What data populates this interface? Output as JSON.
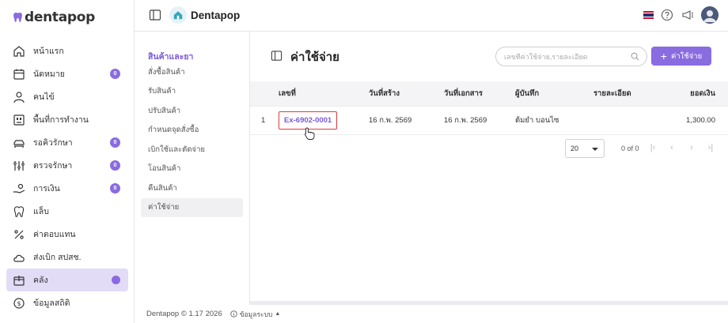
{
  "brand": {
    "name": "dentapop",
    "accent": "#8a6be0"
  },
  "sidebar": {
    "items": [
      {
        "label": "หน้าแรก",
        "icon": "home-icon",
        "badge": null
      },
      {
        "label": "นัดหมาย",
        "icon": "calendar-icon",
        "badge": "0"
      },
      {
        "label": "คนไข้",
        "icon": "user-icon",
        "badge": null
      },
      {
        "label": "พื้นที่การทำงาน",
        "icon": "workspace-icon",
        "badge": null
      },
      {
        "label": "รอคิวรักษา",
        "icon": "queue-icon",
        "badge": "0"
      },
      {
        "label": "ตรวจรักษา",
        "icon": "treatment-icon",
        "badge": "0"
      },
      {
        "label": "การเงิน",
        "icon": "finance-icon",
        "badge": "0"
      },
      {
        "label": "แล็บ",
        "icon": "tooth-icon",
        "badge": null
      },
      {
        "label": "ค่าตอบแทน",
        "icon": "percent-icon",
        "badge": null
      },
      {
        "label": "ส่งเบิก สปสช.",
        "icon": "cloud-icon",
        "badge": null
      },
      {
        "label": "คลัง",
        "icon": "inventory-icon",
        "badge": null,
        "active": true
      },
      {
        "label": "ข้อมูลสถิติ",
        "icon": "stats-icon",
        "badge": null
      }
    ]
  },
  "topbar": {
    "app_title": "Dentapop"
  },
  "subnav": {
    "title": "สินค้าและยา",
    "items": [
      "สั่งซื้อสินค้า",
      "รับสินค้า",
      "ปรับสินค้า",
      "กำหนดจุดสั่งซื้อ",
      "เบิกใช้และตัดจ่าย",
      "โอนสินค้า",
      "คืนสินค้า",
      "ค่าใช้จ่าย"
    ]
  },
  "page": {
    "title": "ค่าใช้จ่าย",
    "search_placeholder": "เลขที่ค่าใช้จ่าย,รายละเอียด",
    "add_label": "ค่าใช้จ่าย"
  },
  "table": {
    "headers": {
      "no": "เลขที่",
      "created": "วันที่สร้าง",
      "doc_date": "วันที่เอกสาร",
      "recorder": "ผู้บันทึก",
      "detail": "รายละเอียด",
      "amount": "ยอดเงิน"
    },
    "rows": [
      {
        "index": "1",
        "no": "Ex-6902-0001",
        "created": "16 ก.พ. 2569",
        "doc_date": "16 ก.พ. 2569",
        "recorder": "ต้มยำ บอนไซ",
        "detail": "",
        "amount": "1,300.00"
      }
    ]
  },
  "pager": {
    "page_size": "20",
    "info": "0 of 0"
  },
  "footer": {
    "copyright": "Dentapop © 1.17 2026",
    "system": "ข้อมูลระบบ"
  }
}
